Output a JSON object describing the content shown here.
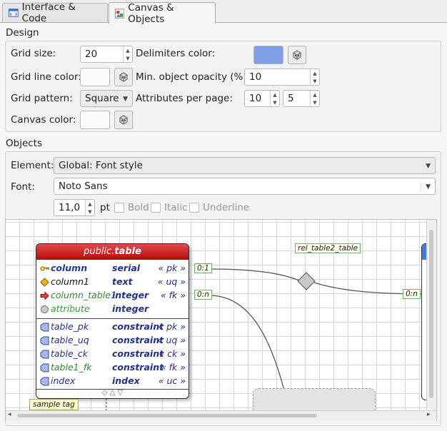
{
  "tabs": [
    {
      "label": "Interface & Code",
      "active": false,
      "icon": "code-window-icon"
    },
    {
      "label": "Canvas & Objects",
      "active": true,
      "icon": "shapes-icon"
    }
  ],
  "design": {
    "title": "Design",
    "grid_size_label": "Grid size:",
    "grid_size_value": "20",
    "delimiters_color_label": "Delimiters color:",
    "delimiters_color": "#7f9fe8",
    "grid_line_color_label": "Grid line color:",
    "min_opacity_label": "Min. object opacity (%):",
    "min_opacity_value": "10",
    "grid_pattern_label": "Grid pattern:",
    "grid_pattern_value": "Square",
    "attributes_per_page_label": "Attributes per page:",
    "attributes_per_page_value_1": "10",
    "attributes_per_page_value_2": "5",
    "canvas_color_label": "Canvas color:"
  },
  "objects": {
    "title": "Objects",
    "element_label": "Element:",
    "element_value": "Global: Font style",
    "font_label": "Font:",
    "font_value": "Noto Sans",
    "font_size_value": "11,0",
    "font_size_unit": "pt",
    "bold_label": "Bold",
    "italic_label": "Italic",
    "underline_label": "Underline"
  },
  "preview": {
    "table_schema": "public.",
    "table_name": "table",
    "columns": [
      {
        "name": "column",
        "type": "serial",
        "constraint": "« pk »",
        "icon": "key-icon"
      },
      {
        "name": "column1",
        "type": "text",
        "constraint": "« uq »",
        "icon": "diamond-icon"
      },
      {
        "name": "column_table1",
        "type": "integer",
        "constraint": "« fk »",
        "icon": "arrow-right-icon"
      },
      {
        "name": "attribute",
        "type": "integer",
        "constraint": "",
        "icon": "circle-icon"
      }
    ],
    "constraints": [
      {
        "name": "table_pk",
        "type": "constraint",
        "constraint": "« pk »"
      },
      {
        "name": "table_uq",
        "type": "constraint",
        "constraint": "« uq »"
      },
      {
        "name": "table_ck",
        "type": "constraint",
        "constraint": "« ck »"
      },
      {
        "name": "table1_fk",
        "type": "constraint",
        "constraint": "« fk »"
      },
      {
        "name": "index",
        "type": "index",
        "constraint": "« uc »"
      }
    ],
    "footer_glyphs": "◇  △  ▽",
    "sample_tag": "sample tag",
    "relationship_label": "rel_table2_table",
    "cardinality_1": "0:1",
    "cardinality_2": "0:n",
    "cardinality_3": "0:n"
  }
}
